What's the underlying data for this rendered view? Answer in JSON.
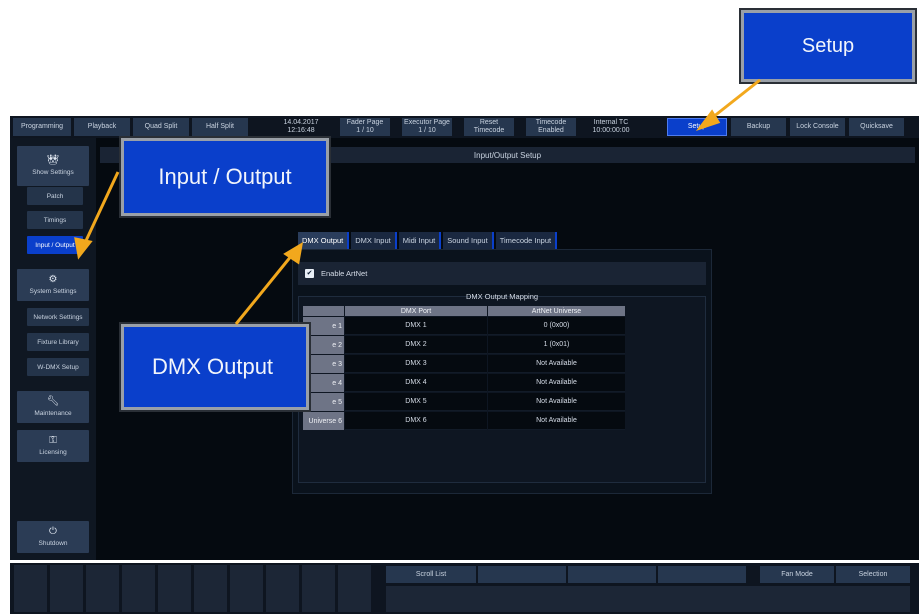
{
  "topbar": {
    "buttons": [
      "Programming",
      "Playback",
      "Quad Split",
      "Half Split"
    ],
    "date": "14.04.2017",
    "time": "12:16:48",
    "fader_page": {
      "label": "Fader Page",
      "value": "1 / 10"
    },
    "executor_page": {
      "label": "Executor Page",
      "value": "1 / 10"
    },
    "reset_timecode": {
      "line1": "Reset",
      "line2": "Timecode"
    },
    "timecode": {
      "line1": "Timecode",
      "line2": "Enabled"
    },
    "internal_tc": {
      "line1": "Internal TC",
      "line2": "10:00:00:00"
    },
    "setup": "Setup",
    "backup": "Backup",
    "lock_console": "Lock Console",
    "quicksave": "Quicksave"
  },
  "sidebar": {
    "show_settings": "Show Settings",
    "patch": "Patch",
    "timings": "Timings",
    "input_output": "Input / Output",
    "system_settings": "System Settings",
    "network_settings": "Network Settings",
    "fixture_library": "Fixture Library",
    "wdmx_setup": "W-DMX Setup",
    "maintenance": "Maintenance",
    "licensing": "Licensing",
    "shutdown": "Shutdown"
  },
  "main": {
    "title": "Input/Output Setup",
    "tabs": [
      "DMX Output",
      "DMX Input",
      "Midi Input",
      "Sound Input",
      "Timecode Input"
    ],
    "enable_artnet": "Enable ArtNet",
    "mapping_title": "DMX Output Mapping",
    "columns": [
      "DMX Port",
      "ArtNet Universe"
    ],
    "rows": [
      {
        "label": "e 1",
        "port": "DMX 1",
        "universe": "0 (0x00)"
      },
      {
        "label": "e 2",
        "port": "DMX 2",
        "universe": "1 (0x01)"
      },
      {
        "label": "e 3",
        "port": "DMX 3",
        "universe": "Not Available"
      },
      {
        "label": "e 4",
        "port": "DMX 4",
        "universe": "Not Available"
      },
      {
        "label": "e 5",
        "port": "DMX 5",
        "universe": "Not Available"
      },
      {
        "label": "Universe 6",
        "port": "DMX 6",
        "universe": "Not Available"
      }
    ]
  },
  "bottombar": {
    "scroll_list": "Scroll List",
    "fan_mode": "Fan Mode",
    "selection": "Selection"
  },
  "callouts": {
    "setup": "Setup",
    "input_output": "Input / Output",
    "dmx_output": "DMX Output"
  },
  "colors": {
    "accent": "#0a3fcb",
    "arrow": "#f2a81d",
    "background": "#050a10"
  }
}
